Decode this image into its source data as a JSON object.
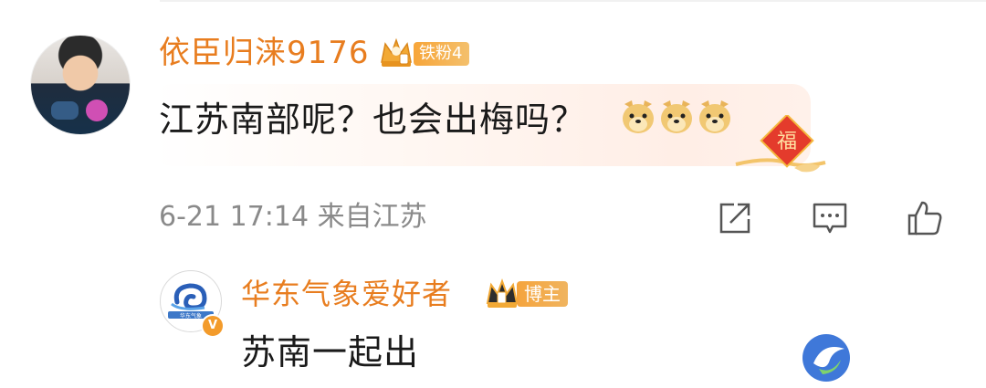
{
  "comment": {
    "username": "依臣归涞9176",
    "fan_badge": "铁粉4",
    "text": "江苏南部呢？也会出梅吗？",
    "emojis": [
      "doge-emoji",
      "doge-emoji",
      "doge-emoji"
    ],
    "fu_badge_char": "福",
    "meta": "6-21 17:14 来自江苏"
  },
  "actions": [
    {
      "name": "share-icon"
    },
    {
      "name": "comment-icon"
    },
    {
      "name": "like-icon"
    }
  ],
  "reply": {
    "username": "华东气象爱好者",
    "host_badge": "博主",
    "avatar_text": "华东气象",
    "verified": "V",
    "text": "苏南一起出"
  },
  "colors": {
    "username": "#e87d1f",
    "badge": "#f4a63a",
    "text": "#1a1a1a",
    "meta": "#8a8a8a"
  }
}
